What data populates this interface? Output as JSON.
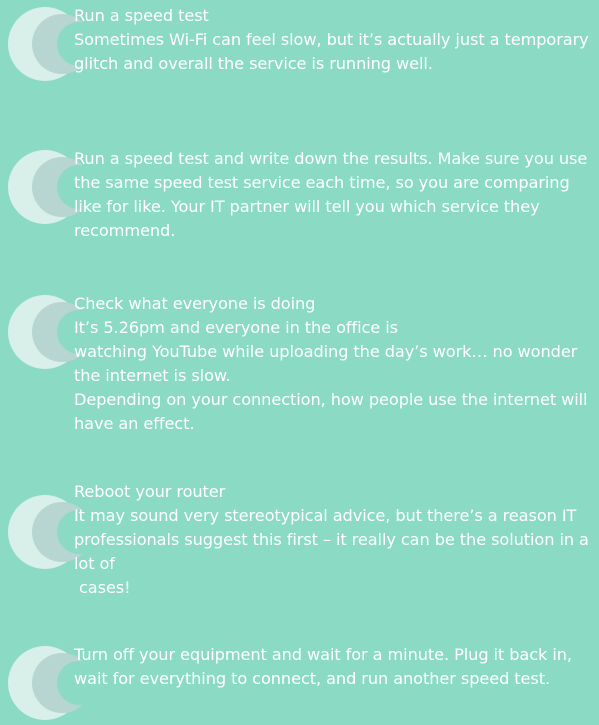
{
  "tips": [
    {
      "lines": [
        "Run a speed test",
        "Sometimes Wi-Fi can feel slow, but it’s actually just a temporary glitch and overall the service is running well."
      ]
    },
    {
      "lines": [
        "Run a speed test and write down the results. Make sure you use the same speed test service each time, so you are comparing like for like. Your IT partner will tell you which service they recommend."
      ]
    },
    {
      "lines": [
        "Check what everyone is doing",
        "It’s 5.26pm and everyone in the office is",
        "watching YouTube while uploading the day’s work… no wonder the internet is slow.",
        "Depending on your connection, how people use the internet will have an effect."
      ]
    },
    {
      "lines": [
        "Reboot your router",
        "It may sound very stereotypical advice, but there’s a reason IT professionals suggest this first – it really can be the solution in a lot of",
        "cases!"
      ]
    },
    {
      "lines": [
        "Turn off your equipment and wait for a minute. Plug it back in, wait for everything to connect, and run another speed test."
      ]
    }
  ],
  "icon": "circle-bubble-icon",
  "colors": {
    "background": "#8bdac4",
    "text": "#ffffff",
    "icon_outer": "#d9efe9",
    "icon_inner": "#b7d6d1"
  }
}
